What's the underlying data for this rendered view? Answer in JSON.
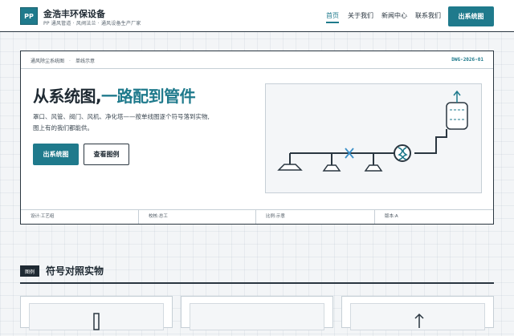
{
  "header": {
    "logo_text": "PP",
    "brand_name": "金浩丰环保设备",
    "brand_tagline": "PP 通风管道 · 风阀法兰 · 通风设备生产厂家",
    "nav": [
      {
        "label": "首页",
        "active": true
      },
      {
        "label": "关于我们",
        "active": false
      },
      {
        "label": "新闻中心",
        "active": false
      },
      {
        "label": "联系我们",
        "active": false
      }
    ],
    "cta_label": "出系统图"
  },
  "hero": {
    "breadcrumb": [
      "通风除尘系统图",
      "单线示意"
    ],
    "drawing_no": "DWG-2026-01",
    "title_main": "从系统图,",
    "title_accent": "一路配到管件",
    "description": "罩口、风管、阀门、风机、净化塔——按单线图逐个符号落到实物,图上有的我们都能供。",
    "primary_button": "出系统图",
    "secondary_button": "查看图例",
    "meta": [
      "设计:工艺组",
      "校核:总工",
      "比例:示意",
      "版本:A"
    ]
  },
  "section": {
    "badge": "图例",
    "title": "符号对照实物"
  },
  "colors": {
    "accent": "#1f7a8c",
    "ink": "#1f2a33",
    "line": "#2a3640",
    "valve": "#3a8fc8"
  }
}
